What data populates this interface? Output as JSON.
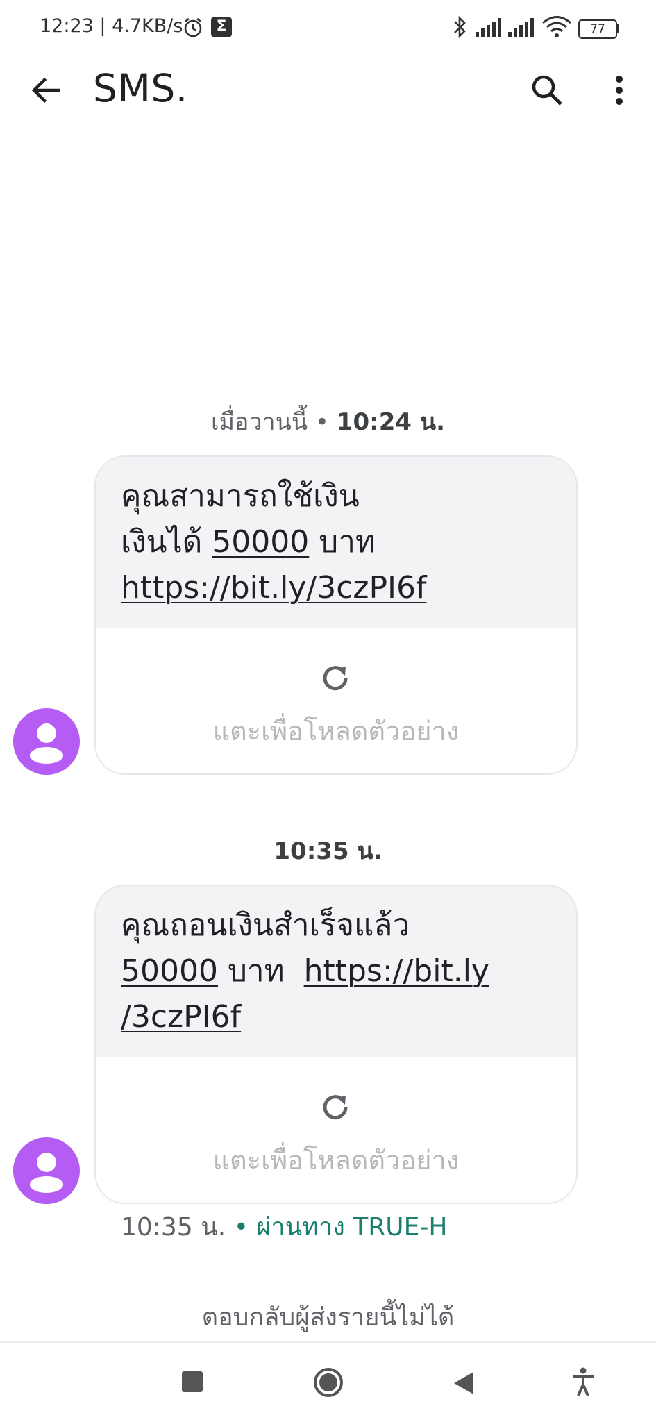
{
  "status_bar": {
    "time_speed": "12:23 | 4.7KB/s",
    "sigma": "Σ",
    "battery": "77"
  },
  "app_bar": {
    "title": "SMS."
  },
  "messages": [
    {
      "timestamp_prefix": "เมื่อวานนี้ • ",
      "timestamp_time": "10:24 น.",
      "text_lines": [
        "คุณสามารถใช้เงิน",
        "เงินได้ ",
        "50000",
        " บาท",
        "https://bit.ly/3czPI6f"
      ],
      "preview_label": "แตะเพื่อโหลดตัวอย่าง"
    },
    {
      "timestamp_time": "10:35 น.",
      "text_lines": [
        "คุณถอนเงินสำเร็จแล้ว",
        "50000",
        " บาท  ",
        "https://bit.ly",
        "/3czPI6f"
      ],
      "preview_label": "แตะเพื่อโหลดตัวอย่าง"
    }
  ],
  "meta": {
    "time": "10:35 น.",
    "via": " • ผ่านทาง TRUE-H"
  },
  "footer": {
    "no_reply": "ตอบกลับผู้ส่งรายนี้ไม่ได้"
  },
  "colors": {
    "avatar": "#b45cf3",
    "via": "#1a7f6d",
    "bubble_bg": "#f1f3f4"
  }
}
